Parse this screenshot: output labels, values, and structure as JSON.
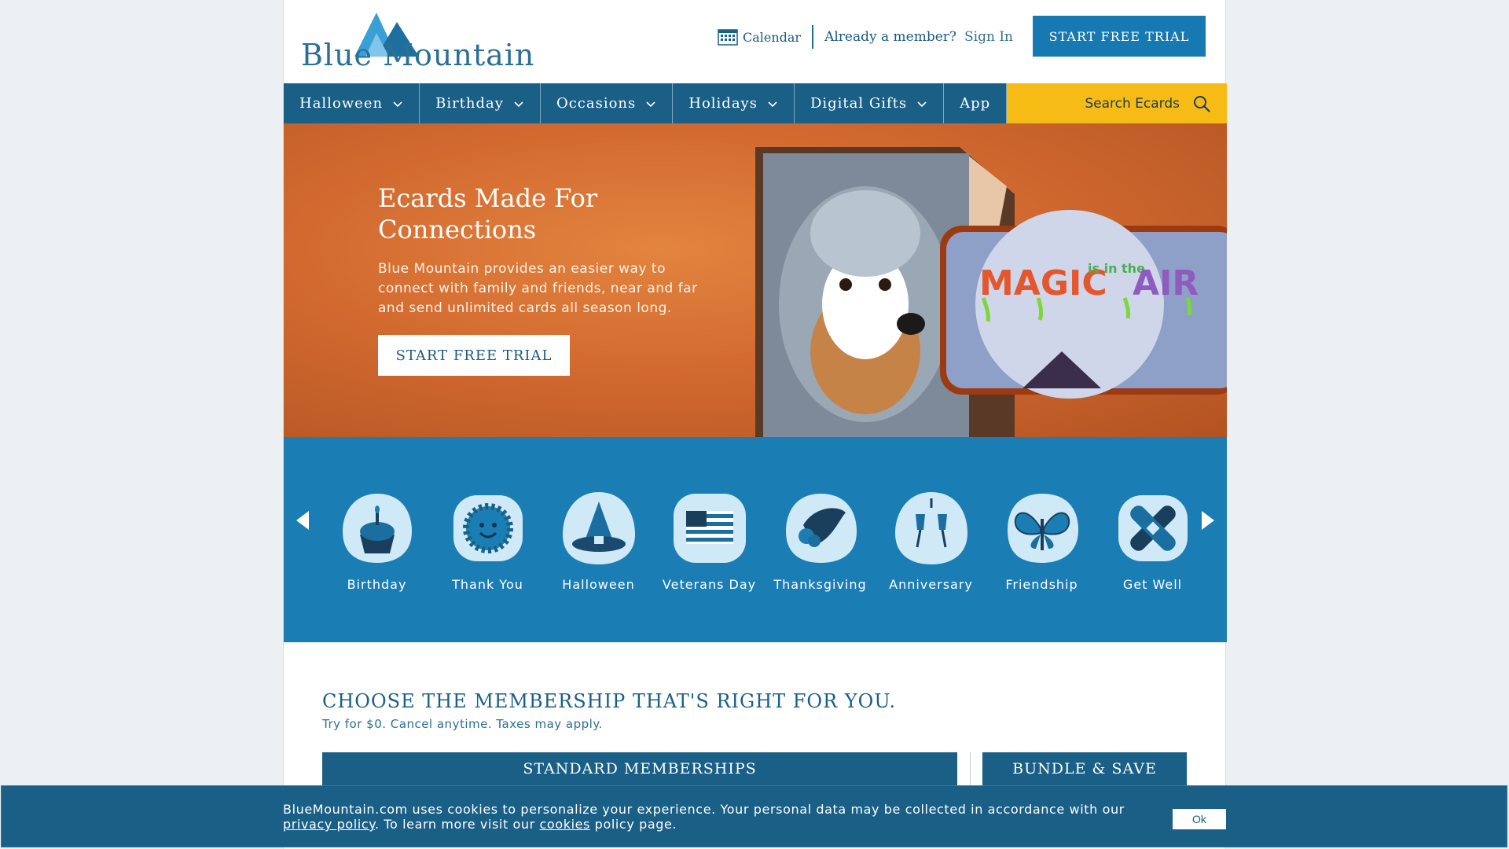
{
  "header": {
    "logo_text": "Blue Mountain",
    "calendar_label": "Calendar",
    "member_prompt": "Already a member?",
    "signin_label": "Sign In",
    "trial_button": "START FREE TRIAL"
  },
  "nav": {
    "items": [
      {
        "label": "Halloween",
        "has_dropdown": true
      },
      {
        "label": "Birthday",
        "has_dropdown": true
      },
      {
        "label": "Occasions",
        "has_dropdown": true
      },
      {
        "label": "Holidays",
        "has_dropdown": true
      },
      {
        "label": "Digital Gifts",
        "has_dropdown": true
      },
      {
        "label": "App",
        "has_dropdown": false
      }
    ],
    "search_label": "Search Ecards"
  },
  "hero": {
    "title": "Ecards Made For Connections",
    "body": "Blue Mountain provides an easier way to connect with family and friends, near and far and send unlimited cards all season long.",
    "button": "START FREE TRIAL",
    "card_text_1": "MAGIC",
    "card_text_2": "is in the",
    "card_text_3": "AIR"
  },
  "categories": {
    "items": [
      {
        "label": "Birthday",
        "icon": "cupcake-icon"
      },
      {
        "label": "Thank You",
        "icon": "sun-smile-icon"
      },
      {
        "label": "Halloween",
        "icon": "witch-hat-icon"
      },
      {
        "label": "Veterans Day",
        "icon": "us-flag-icon"
      },
      {
        "label": "Thanksgiving",
        "icon": "cornucopia-icon"
      },
      {
        "label": "Anniversary",
        "icon": "champagne-glasses-icon"
      },
      {
        "label": "Friendship",
        "icon": "butterfly-icon"
      },
      {
        "label": "Get Well",
        "icon": "bandage-icon"
      }
    ]
  },
  "membership": {
    "title": "CHOOSE THE MEMBERSHIP THAT'S RIGHT FOR YOU.",
    "subtitle": "Try for $0. Cancel anytime. Taxes may apply.",
    "tab_standard": "STANDARD MEMBERSHIPS",
    "tab_bundle": "BUNDLE & SAVE"
  },
  "cookie": {
    "text_before": "BlueMountain.com uses cookies to personalize your experience. Your personal data may be collected in accordance with our ",
    "privacy_link": "privacy policy",
    "text_middle": ". To learn more visit our ",
    "cookies_link": "cookies",
    "text_after": " policy page.",
    "ok_button": "Ok"
  },
  "colors": {
    "nav_blue": "#1a5f86",
    "button_blue": "#1679b2",
    "category_band": "#1a7eb4",
    "search_yellow": "#f7bb16",
    "hero_orange": "#d26a30"
  }
}
